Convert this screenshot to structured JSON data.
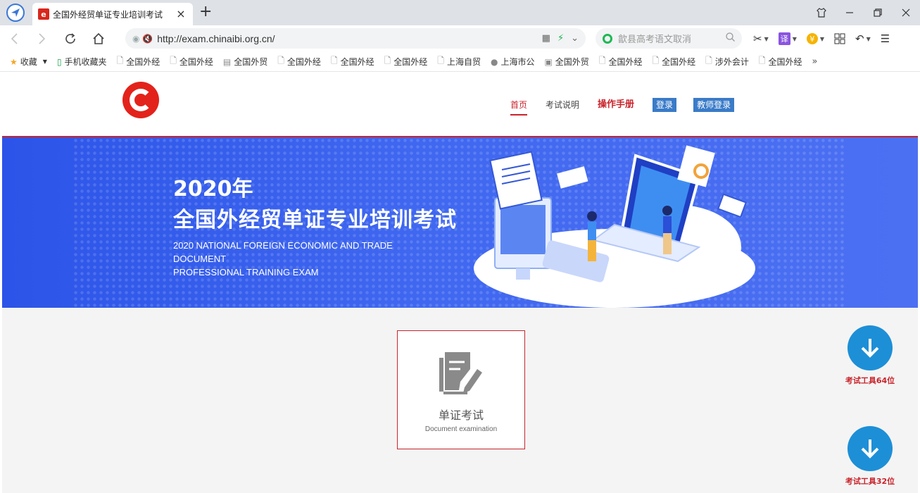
{
  "browser": {
    "tab_title": "全国外经贸单证专业培训考试",
    "tab_close": "×",
    "new_tab": "+",
    "url": "http://exam.chinaibi.org.cn/",
    "search_placeholder": "歙县高考语文取消",
    "bookmarks": [
      {
        "label": "收藏",
        "icon": "star-icon"
      },
      {
        "label": "手机收藏夹",
        "icon": "phone-icon"
      },
      {
        "label": "全国外经",
        "icon": "page-icon"
      },
      {
        "label": "全国外经",
        "icon": "page-icon"
      },
      {
        "label": "全国外贸",
        "icon": "doc-icon"
      },
      {
        "label": "全国外经",
        "icon": "page-icon"
      },
      {
        "label": "全国外经",
        "icon": "page-icon"
      },
      {
        "label": "全国外经",
        "icon": "page-icon"
      },
      {
        "label": "上海自贸",
        "icon": "page-icon"
      },
      {
        "label": "上海市公",
        "icon": "emblem-icon"
      },
      {
        "label": "全国外贸",
        "icon": "site-icon"
      },
      {
        "label": "全国外经",
        "icon": "page-icon"
      },
      {
        "label": "全国外经",
        "icon": "page-icon"
      },
      {
        "label": "涉外会计",
        "icon": "page-icon"
      },
      {
        "label": "全国外经",
        "icon": "page-icon"
      }
    ],
    "bookmarks_more": "»"
  },
  "site": {
    "nav": {
      "home": "首页",
      "exam_info": "考试说明",
      "manual": "操作手册",
      "login": "登录",
      "teacher_login": "教师登录"
    },
    "banner": {
      "year": "2020年",
      "title": "全国外经贸单证专业培训考试",
      "en_line1": "2020 NATIONAL FOREIGN ECONOMIC AND TRADE DOCUMENT",
      "en_line2": "PROFESSIONAL TRAINING EXAM"
    },
    "exam_card": {
      "label": "单证考试",
      "sublabel": "Document examination"
    },
    "downloads": [
      {
        "label": "考试工具64位"
      },
      {
        "label": "考试工具32位"
      }
    ]
  },
  "colors": {
    "brand_red": "#c8242b",
    "banner_blue": "#3a62ee",
    "download_blue": "#1d8fd7",
    "nav_button_blue": "#3a7bc8"
  }
}
